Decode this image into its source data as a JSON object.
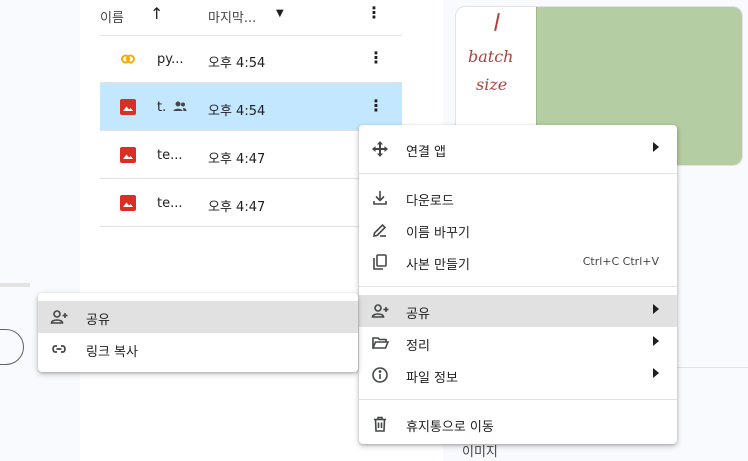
{
  "list": {
    "header": {
      "name_col": "이름",
      "modified_col": "마지막..."
    },
    "rows": [
      {
        "name": "py...",
        "time": "오후 4:54",
        "type": "colab",
        "selected": false
      },
      {
        "name": "t.",
        "time": "오후 4:54",
        "type": "image",
        "selected": true,
        "shared": true
      },
      {
        "name": "te...",
        "time": "오후 4:47",
        "type": "image",
        "selected": false
      },
      {
        "name": "te...",
        "time": "오후 4:47",
        "type": "image",
        "selected": false
      }
    ]
  },
  "preview": {
    "handwriting": [
      "batch",
      "size"
    ],
    "type_label": "이미지"
  },
  "context_menu": {
    "open_with": "연결 앱",
    "download": "다운로드",
    "rename": "이름 바꾸기",
    "make_copy": "사본 만들기",
    "make_copy_shortcut": "Ctrl+C Ctrl+V",
    "share": "공유",
    "organize": "정리",
    "file_info": "파일 정보",
    "trash": "휴지통으로 이동"
  },
  "share_submenu": {
    "share": "공유",
    "copy_link": "링크 복사"
  },
  "colors": {
    "selection": "#c2e7ff",
    "highlight": "#e1e1e1",
    "image_icon": "#d93025",
    "colab_icon": "#f9ab00"
  }
}
